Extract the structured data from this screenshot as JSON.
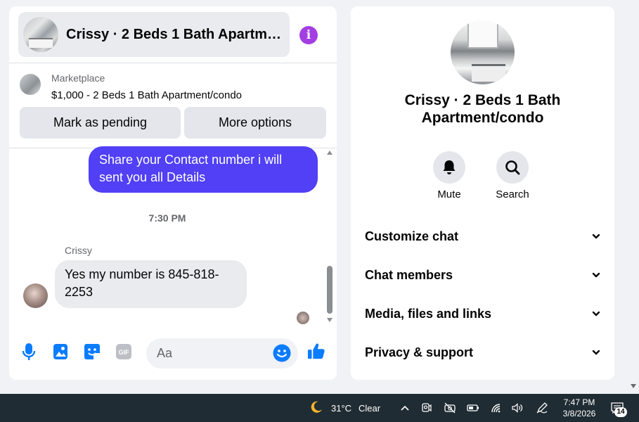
{
  "colors": {
    "accent": "#5140f5",
    "brand": "#0a7cff",
    "info": "#a33ee3",
    "taskbar": "#202c33"
  },
  "chat": {
    "header_title": "Crissy · 2 Beds 1 Bath Apartment/condo",
    "info_icon": "info-icon",
    "marketplace": {
      "label": "Marketplace",
      "listing": "$1,000 - 2 Beds 1 Bath Apartment/condo"
    },
    "buttons": {
      "pending": "Mark as pending",
      "more": "More options"
    },
    "messages": {
      "outgoing": "Share your Contact number i will sent you all Details",
      "timestamp": "7:30 PM",
      "sender_name": "Crissy",
      "incoming": "Yes my number is 845-818-2253"
    },
    "composer": {
      "placeholder": "Aa",
      "icons": [
        "microphone-icon",
        "image-icon",
        "sticker-icon",
        "gif-icon",
        "emoji-icon",
        "thumbs-up-icon"
      ],
      "gif_label": "GIF"
    }
  },
  "info": {
    "name": "Crissy · 2 Beds 1 Bath Apartment/condo",
    "actions": {
      "mute": "Mute",
      "search": "Search"
    },
    "sections": [
      {
        "label": "Customize chat"
      },
      {
        "label": "Chat members"
      },
      {
        "label": "Media, files and links"
      },
      {
        "label": "Privacy & support"
      }
    ]
  },
  "taskbar": {
    "temperature": "31°C",
    "condition": "Clear",
    "time": "7:47 PM",
    "date": "3/8/2026",
    "notification_count": "14"
  }
}
